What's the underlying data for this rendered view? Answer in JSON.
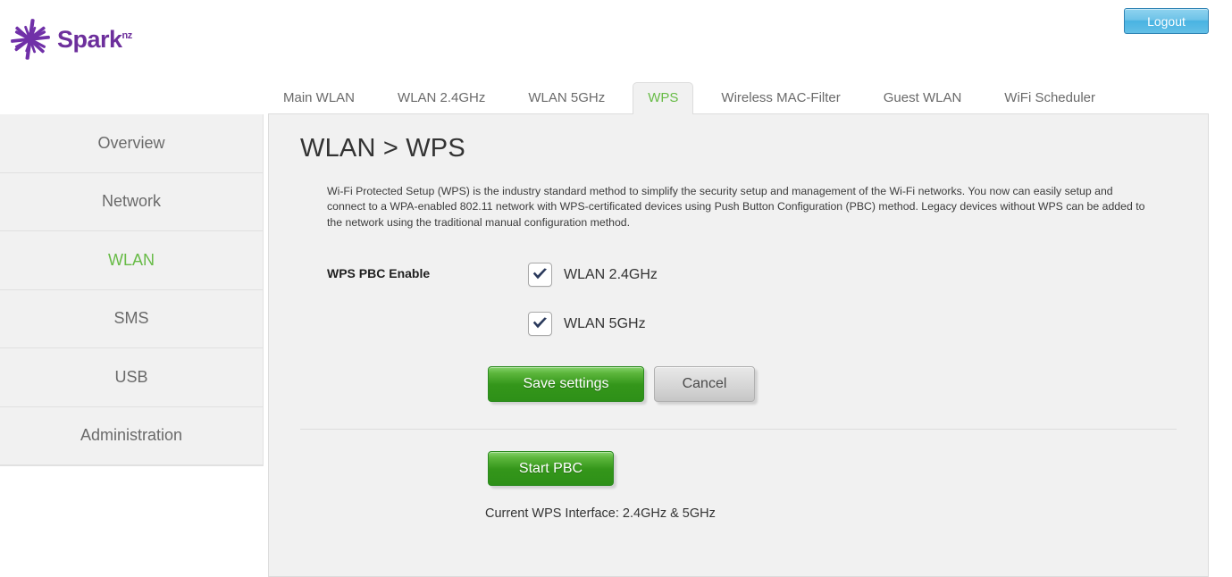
{
  "header": {
    "brand_name": "Spark",
    "brand_sup": "nz",
    "brand_color": "#6d2f9c",
    "logout_label": "Logout"
  },
  "tabs": [
    {
      "label": "Main WLAN",
      "active": false
    },
    {
      "label": "WLAN 2.4GHz",
      "active": false
    },
    {
      "label": "WLAN 5GHz",
      "active": false
    },
    {
      "label": "WPS",
      "active": true
    },
    {
      "label": "Wireless MAC-Filter",
      "active": false
    },
    {
      "label": "Guest WLAN",
      "active": false
    },
    {
      "label": "WiFi Scheduler",
      "active": false
    }
  ],
  "sidebar": {
    "items": [
      {
        "label": "Overview",
        "active": false
      },
      {
        "label": "Network",
        "active": false
      },
      {
        "label": "WLAN",
        "active": true
      },
      {
        "label": "SMS",
        "active": false
      },
      {
        "label": "USB",
        "active": false
      },
      {
        "label": "Administration",
        "active": false
      }
    ],
    "active_color": "#67bb46"
  },
  "main": {
    "title": "WLAN > WPS",
    "description": "Wi-Fi Protected Setup (WPS) is the industry standard method to simplify the security setup and management of the Wi-Fi networks. You now can easily setup and connect to a WPA-enabled 802.11 network with WPS-certificated devices using Push Button Configuration (PBC) method. Legacy devices without WPS can be added to the network using the traditional manual configuration method.",
    "form": {
      "label": "WPS PBC Enable",
      "checkboxes": [
        {
          "label": "WLAN 2.4GHz",
          "checked": true
        },
        {
          "label": "WLAN 5GHz",
          "checked": true
        }
      ]
    },
    "buttons": {
      "save_label": "Save settings",
      "cancel_label": "Cancel",
      "start_pbc_label": "Start PBC"
    },
    "pbc_status": "Current WPS Interface: 2.4GHz & 5GHz"
  },
  "colors": {
    "accent_green": "#67bb46",
    "button_green": "#34961a",
    "panel_bg": "#f1f1f1",
    "logout_blue": "#49b3e2"
  }
}
